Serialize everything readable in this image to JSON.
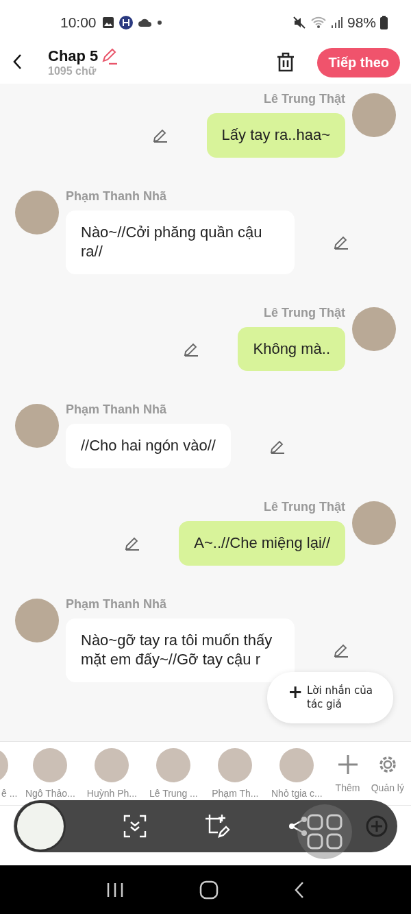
{
  "status_bar": {
    "time": "10:00",
    "battery": "98%"
  },
  "header": {
    "title": "Chap 5",
    "subtitle": "1095 chữ",
    "next_button": "Tiếp theo"
  },
  "messages": [
    {
      "kind": "outgoing",
      "author": "Lê Trung Thật",
      "text": "Lấy tay ra..haa~"
    },
    {
      "kind": "incoming",
      "author": "Phạm Thanh Nhã",
      "text": "Nào~//Cởi phăng quần cậu ra//"
    },
    {
      "kind": "outgoing",
      "author": "Lê Trung Thật",
      "text": "Không mà.."
    },
    {
      "kind": "incoming",
      "author": "Phạm Thanh Nhã",
      "text": "//Cho hai ngón vào//"
    },
    {
      "kind": "outgoing",
      "author": "Lê Trung Thật",
      "text": "A~..//Che miệng lại//"
    },
    {
      "kind": "incoming",
      "author": "Phạm Thanh Nhã",
      "text": "Nào~gỡ tay ra tôi muốn thấy mặt em đấy~//Gỡ tay cậu r"
    }
  ],
  "author_note_button": {
    "icon": "+",
    "label": "Lời nhắn của tác giả"
  },
  "characters": [
    {
      "name": "ê ..."
    },
    {
      "name": "Ngô Thảo..."
    },
    {
      "name": "Huỳnh Ph..."
    },
    {
      "name": "Lê Trung ..."
    },
    {
      "name": "Phạm Th..."
    },
    {
      "name": "Nhỏ tgia c..."
    }
  ],
  "character_actions": [
    {
      "kind": "add",
      "label": "Thêm"
    },
    {
      "kind": "manage",
      "label": "Quản lý"
    }
  ]
}
